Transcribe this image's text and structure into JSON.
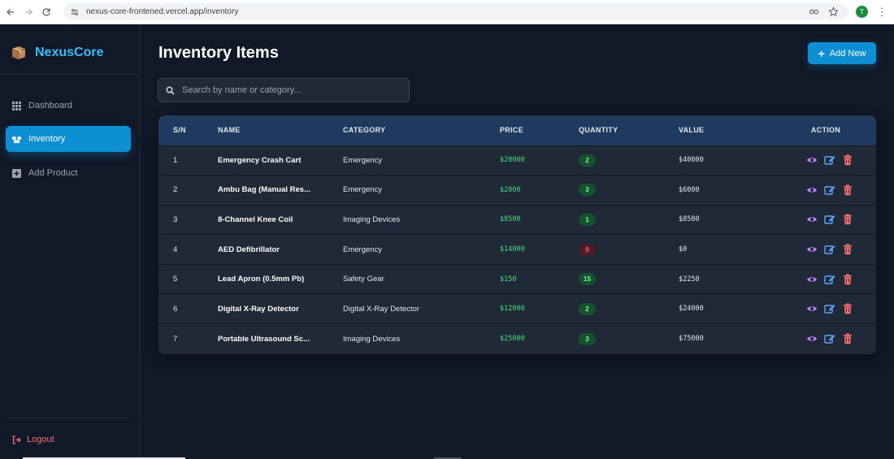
{
  "browser": {
    "url": "nexus-core-frontened.vercel.app/inventory",
    "profile_initial": "T"
  },
  "brand": {
    "name": "NexusCore"
  },
  "sidebar": {
    "items": [
      {
        "label": "Dashboard",
        "icon": "grid-icon"
      },
      {
        "label": "Inventory",
        "icon": "boxes-icon"
      },
      {
        "label": "Add Product",
        "icon": "plus-square-icon"
      }
    ],
    "logout": "Logout"
  },
  "page": {
    "title": "Inventory Items",
    "add_label": "Add New"
  },
  "search": {
    "placeholder": "Search by name or category..."
  },
  "table": {
    "headers": [
      "S/N",
      "NAME",
      "CATEGORY",
      "PRICE",
      "QUANTITY",
      "VALUE",
      "ACTION"
    ],
    "rows": [
      {
        "sn": "1",
        "name": "Emergency Crash Cart",
        "category": "Emergency",
        "price": "$20000",
        "qty": "2",
        "value": "$40000"
      },
      {
        "sn": "2",
        "name": "Ambu Bag (Manual Res...",
        "category": "Emergency",
        "price": "$2000",
        "qty": "3",
        "value": "$6000"
      },
      {
        "sn": "3",
        "name": "8-Channel Knee Coil",
        "category": "Imaging Devices",
        "price": "$8500",
        "qty": "1",
        "value": "$8500"
      },
      {
        "sn": "4",
        "name": "AED Defibrillator",
        "category": "Emergency",
        "price": "$14000",
        "qty": "0",
        "value": "$0"
      },
      {
        "sn": "5",
        "name": "Lead Apron (0.5mm Pb)",
        "category": "Safety Gear",
        "price": "$150",
        "qty": "15",
        "value": "$2250"
      },
      {
        "sn": "6",
        "name": "Digital X-Ray Detector",
        "category": "Digital X-Ray Detector",
        "price": "$12000",
        "qty": "2",
        "value": "$24000"
      },
      {
        "sn": "7",
        "name": "Portable Ultrasound Sc...",
        "category": "Imaging Devices",
        "price": "$25000",
        "qty": "3",
        "value": "$75000"
      }
    ]
  },
  "colors": {
    "accent": "#0e8fd3",
    "brand": "#38bdf8",
    "price": "#4ade80",
    "view": "#c084fc",
    "edit": "#60a5fa",
    "delete": "#f87171"
  }
}
